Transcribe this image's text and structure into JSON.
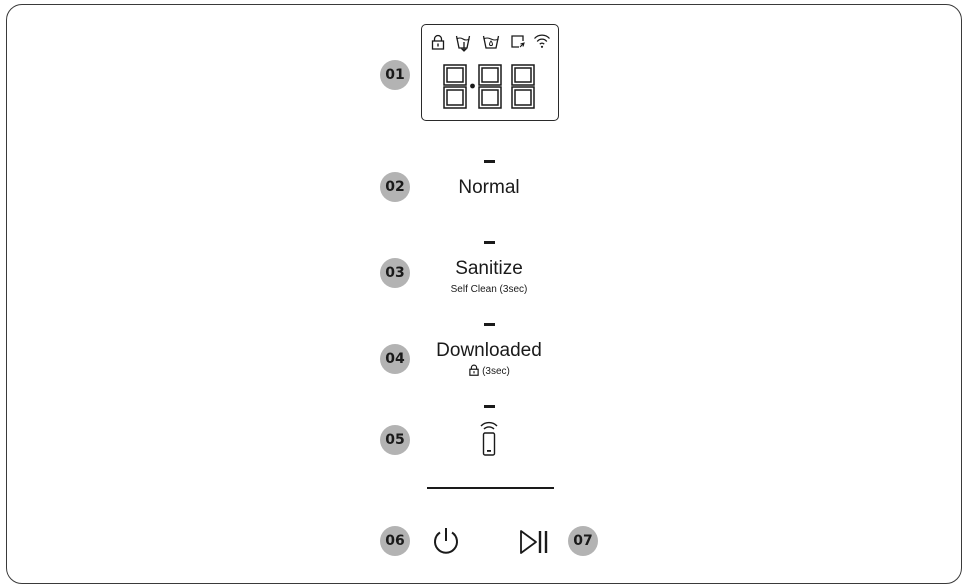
{
  "badges": {
    "b01": "01",
    "b02": "02",
    "b03": "03",
    "b04": "04",
    "b05": "05",
    "b06": "06",
    "b07": "07"
  },
  "display": {
    "digits": "8:88",
    "status_icons": [
      "lock-icon",
      "drain-icon",
      "water-temp-icon",
      "smart-control-icon",
      "wifi-icon"
    ]
  },
  "buttons": {
    "normal": {
      "label": "Normal"
    },
    "sanitize": {
      "label": "Sanitize",
      "sub_label": "Self Clean (3sec)"
    },
    "downloaded": {
      "label": "Downloaded",
      "sub_label": "(3sec)",
      "sub_icon": "lock-icon"
    },
    "smart_control": {
      "icon": "remote-phone-icon"
    },
    "power": {
      "icon": "power-icon"
    },
    "start_pause": {
      "icon": "play-pause-icon"
    }
  },
  "colors": {
    "badge": "#b3b3b3",
    "ink": "#1a1a1a",
    "border": "#3a3a3a"
  }
}
